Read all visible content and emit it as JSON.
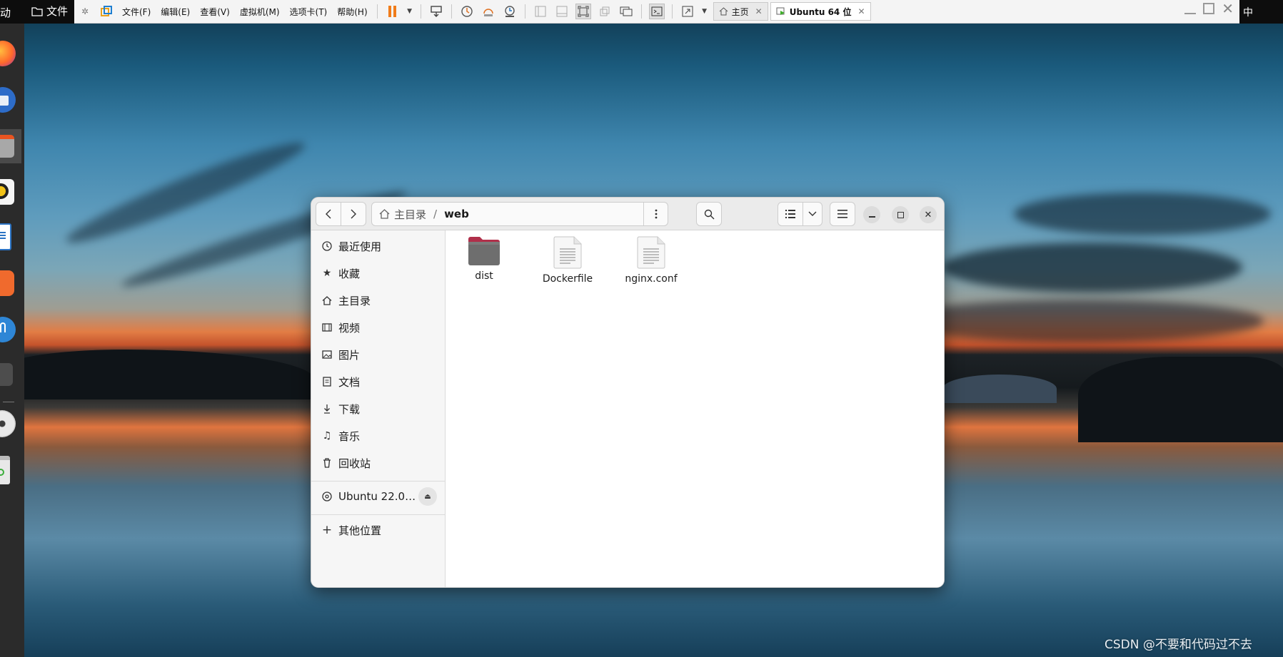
{
  "host": {
    "left_cut_text": "动",
    "files_label": "文件",
    "ime_indicator": "中"
  },
  "vm_toolbar": {
    "menus": [
      "文件(F)",
      "编辑(E)",
      "查看(V)",
      "虚拟机(M)",
      "选项卡(T)",
      "帮助(H)"
    ],
    "tabs": [
      {
        "label": "主页",
        "active": false
      },
      {
        "label": "Ubuntu 64 位",
        "active": true
      }
    ]
  },
  "nautilus": {
    "path": {
      "root": "主目录",
      "current": "web"
    },
    "sidebar": {
      "places": [
        {
          "icon": "clock-icon",
          "label": "最近使用"
        },
        {
          "icon": "star-icon",
          "label": "收藏"
        },
        {
          "icon": "home-icon",
          "label": "主目录"
        },
        {
          "icon": "film-icon",
          "label": "视频"
        },
        {
          "icon": "picture-icon",
          "label": "图片"
        },
        {
          "icon": "document-icon",
          "label": "文档"
        },
        {
          "icon": "download-icon",
          "label": "下载"
        },
        {
          "icon": "music-icon",
          "label": "音乐"
        },
        {
          "icon": "trash-icon",
          "label": "回收站"
        }
      ],
      "devices": [
        {
          "icon": "disc-icon",
          "label": "Ubuntu 22.0…"
        }
      ],
      "other": {
        "icon": "plus-icon",
        "label": "其他位置"
      }
    },
    "files": [
      {
        "name": "dist",
        "type": "folder"
      },
      {
        "name": "Dockerfile",
        "type": "text-file"
      },
      {
        "name": "nginx.conf",
        "type": "text-file"
      }
    ]
  },
  "watermark": "CSDN @不要和代码过不去"
}
